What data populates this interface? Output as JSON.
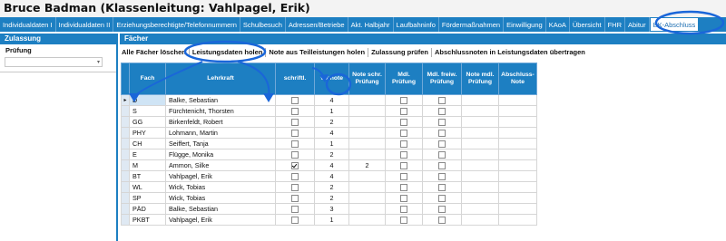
{
  "window": {
    "title": "Bruce Badman (Klassenleitung: Vahlpagel, Erik)"
  },
  "tabs": [
    {
      "label": "Individualdaten I"
    },
    {
      "label": "Individualdaten II"
    },
    {
      "label": "Erziehungsberechtigte/Telefonnummern"
    },
    {
      "label": "Schulbesuch"
    },
    {
      "label": "Adressen/Betriebe"
    },
    {
      "label": "Akt. Halbjahr"
    },
    {
      "label": "Laufbahninfo"
    },
    {
      "label": "Fördermaßnahmen"
    },
    {
      "label": "Einwilligung"
    },
    {
      "label": "KAoA"
    },
    {
      "label": "Übersicht"
    },
    {
      "label": "FHR"
    },
    {
      "label": "Abitur"
    },
    {
      "label": "BK-Abschluss",
      "active": true
    }
  ],
  "left_panel": {
    "header": "Zulassung",
    "field_label": "Prüfung",
    "field_value": ""
  },
  "right_panel": {
    "header": "Fächer",
    "toolbar": [
      {
        "label": "Alle Fächer löschen"
      },
      {
        "label": "Leistungsdaten holen"
      },
      {
        "label": "Note aus Teilleistungen holen"
      },
      {
        "label": "Zulassung prüfen"
      },
      {
        "label": "Abschlussnoten in Leistungsdaten übertragen"
      }
    ]
  },
  "grid": {
    "columns": [
      "Fach",
      "Lehrkraft",
      "schriftl.",
      "Vornote",
      "Note schr. Prüfung",
      "Mdl. Prüfung",
      "Mdl. freiw. Prüfung",
      "Note mdl. Prüfung",
      "Abschluss-Note"
    ],
    "rows": [
      {
        "fach": "D",
        "lehrkraft": "Balke, Sebastian",
        "schriftl": false,
        "vornote": "4",
        "note_schr": "",
        "current": true
      },
      {
        "fach": "S",
        "lehrkraft": "Fürchtenicht, Thorsten",
        "schriftl": false,
        "vornote": "1",
        "note_schr": ""
      },
      {
        "fach": "GG",
        "lehrkraft": "Birkenfeldt, Robert",
        "schriftl": false,
        "vornote": "2",
        "note_schr": ""
      },
      {
        "fach": "PHY",
        "lehrkraft": "Lohmann, Martin",
        "schriftl": false,
        "vornote": "4",
        "note_schr": ""
      },
      {
        "fach": "CH",
        "lehrkraft": "Seiffert, Tanja",
        "schriftl": false,
        "vornote": "1",
        "note_schr": ""
      },
      {
        "fach": "E",
        "lehrkraft": "Flügge, Monika",
        "schriftl": false,
        "vornote": "2",
        "note_schr": ""
      },
      {
        "fach": "M",
        "lehrkraft": "Ammon, Silke",
        "schriftl": true,
        "vornote": "4",
        "note_schr": "2"
      },
      {
        "fach": "BT",
        "lehrkraft": "Vahlpagel, Erik",
        "schriftl": false,
        "vornote": "4",
        "note_schr": ""
      },
      {
        "fach": "WL",
        "lehrkraft": "Wick, Tobias",
        "schriftl": false,
        "vornote": "2",
        "note_schr": ""
      },
      {
        "fach": "SP",
        "lehrkraft": "Wick, Tobias",
        "schriftl": false,
        "vornote": "2",
        "note_schr": ""
      },
      {
        "fach": "PÄD",
        "lehrkraft": "Balke, Sebastian",
        "schriftl": false,
        "vornote": "3",
        "note_schr": ""
      },
      {
        "fach": "PKBT",
        "lehrkraft": "Vahlpagel, Erik",
        "schriftl": false,
        "vornote": "1",
        "note_schr": ""
      }
    ]
  },
  "colors": {
    "accent": "#1d7fc2",
    "annotation": "#1a66d9"
  }
}
